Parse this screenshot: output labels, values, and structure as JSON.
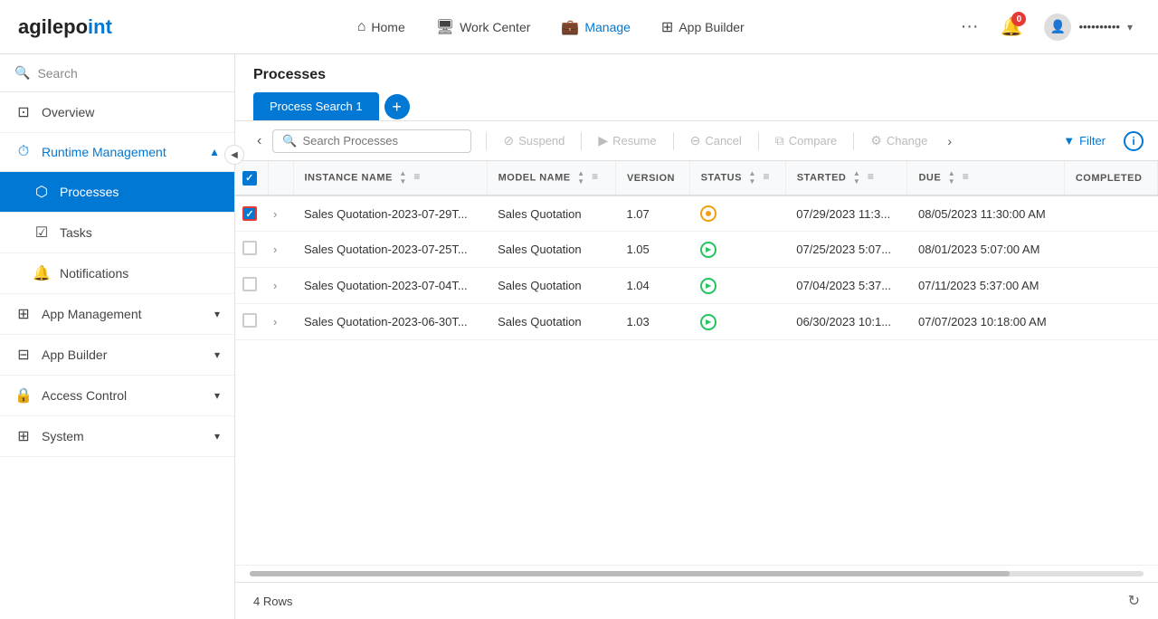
{
  "app": {
    "name_part1": "agilepo",
    "name_part2": "int"
  },
  "topnav": {
    "home_label": "Home",
    "workcenter_label": "Work Center",
    "manage_label": "Manage",
    "appbuilder_label": "App Builder",
    "more_label": "···",
    "notif_count": "0",
    "user_display": "••••••••••"
  },
  "sidebar": {
    "search_placeholder": "Search",
    "overview_label": "Overview",
    "runtime_management_label": "Runtime Management",
    "processes_label": "Processes",
    "tasks_label": "Tasks",
    "notifications_label": "Notifications",
    "app_management_label": "App Management",
    "app_builder_label": "App Builder",
    "access_control_label": "Access Control",
    "system_label": "System"
  },
  "processes": {
    "page_title": "Processes",
    "tab_label": "Process Search 1",
    "add_tab_icon": "+",
    "search_placeholder": "Search Processes",
    "column_instance_name": "INSTANCE NAME",
    "column_model_name": "MODEL NAME",
    "column_version": "VERSION",
    "column_status": "STATUS",
    "column_started": "STARTED",
    "column_due": "DUE",
    "column_completed": "COMPLETED",
    "toolbar": {
      "suspend_label": "Suspend",
      "resume_label": "Resume",
      "cancel_label": "Cancel",
      "compare_label": "Compare",
      "change_label": "Change",
      "filter_label": "Filter"
    },
    "rows": [
      {
        "instance_name": "Sales Quotation-2023-07-29T...",
        "model_name": "Sales Quotation",
        "version": "1.07",
        "status": "orange",
        "started": "07/29/2023 11:3...",
        "due": "08/05/2023 11:30:00 AM",
        "completed": "",
        "checked": true
      },
      {
        "instance_name": "Sales Quotation-2023-07-25T...",
        "model_name": "Sales Quotation",
        "version": "1.05",
        "status": "green",
        "started": "07/25/2023 5:07...",
        "due": "08/01/2023 5:07:00 AM",
        "completed": "",
        "checked": false
      },
      {
        "instance_name": "Sales Quotation-2023-07-04T...",
        "model_name": "Sales Quotation",
        "version": "1.04",
        "status": "green",
        "started": "07/04/2023 5:37...",
        "due": "07/11/2023 5:37:00 AM",
        "completed": "",
        "checked": false
      },
      {
        "instance_name": "Sales Quotation-2023-06-30T...",
        "model_name": "Sales Quotation",
        "version": "1.03",
        "status": "green",
        "started": "06/30/2023 10:1...",
        "due": "07/07/2023 10:18:00 AM",
        "completed": "",
        "checked": false
      }
    ],
    "row_count_label": "4 Rows"
  }
}
